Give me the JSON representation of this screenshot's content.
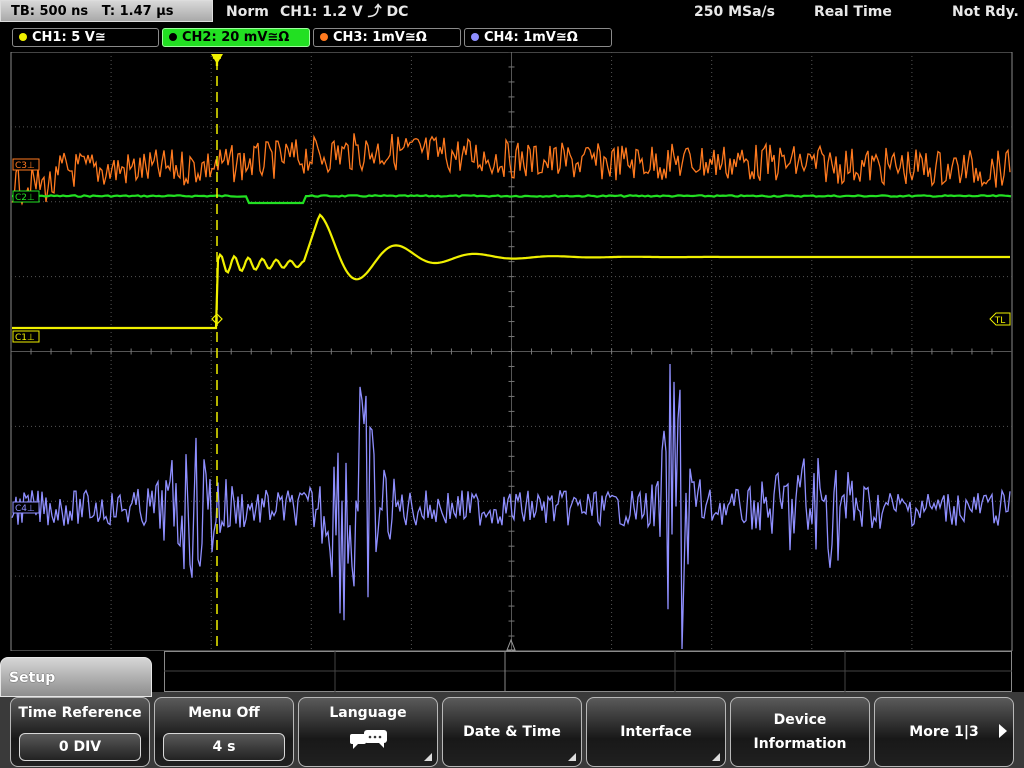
{
  "status": {
    "timebase": "TB: 500 ns",
    "trigger_time": "T: 1.47 µs",
    "trigger_mode": "Norm",
    "trigger_info": "CH1: 1.2 V ⤴ DC",
    "sample_rate": "250 MSa/s",
    "acq_mode": "Real Time",
    "state": "Not Rdy."
  },
  "channels": [
    {
      "label": "CH1: 5 V≅",
      "color": "#f0f000",
      "active": false
    },
    {
      "label": "CH2: 20 mV≅Ω",
      "color": "#22e022",
      "active": true
    },
    {
      "label": "CH3: 1mV≅Ω",
      "color": "#ff7a1f",
      "active": false
    },
    {
      "label": "CH4: 1mV≅Ω",
      "color": "#8f8fff",
      "active": false
    }
  ],
  "markers": {
    "c1": "C1⊥",
    "c2": "C2⊥",
    "c3": "C3⊥",
    "c4": "C4⊥",
    "trigger_level": "TL",
    "trigger_pos": "T"
  },
  "menu": {
    "title": "Setup",
    "softkeys": [
      {
        "label": "Time Reference",
        "value": "0 DIV"
      },
      {
        "label": "Menu Off",
        "value": "4 s"
      },
      {
        "label": "Language",
        "icon": "speech-bubbles-icon"
      },
      {
        "label": "Date & Time"
      },
      {
        "label": "Interface"
      },
      {
        "label_line1": "Device",
        "label_line2": "Information"
      },
      {
        "label": "More 1|3"
      }
    ]
  },
  "colors": {
    "ch1": "#f0f000",
    "ch2": "#22e022",
    "ch3": "#ff7a1f",
    "ch4": "#8f8fff",
    "grid": "#6a6a6a"
  }
}
